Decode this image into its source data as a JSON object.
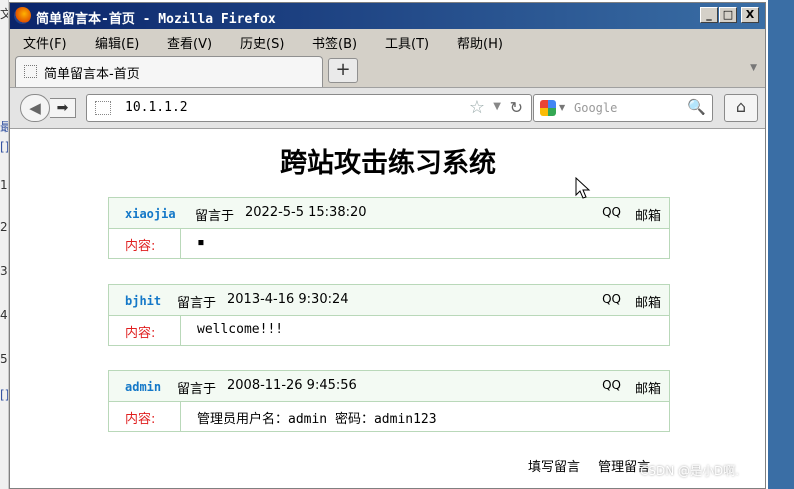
{
  "window": {
    "title": "简单留言本-首页 - Mozilla Firefox",
    "controls": {
      "minimize": "_",
      "maximize": "□",
      "close": "X"
    }
  },
  "menubar": [
    "文件(F)",
    "编辑(E)",
    "查看(V)",
    "历史(S)",
    "书签(B)",
    "工具(T)",
    "帮助(H)"
  ],
  "tabs": [
    {
      "label": "简单留言本-首页"
    }
  ],
  "newtab_label": "+",
  "navigation": {
    "url": "10.1.1.2",
    "search_placeholder": "Google"
  },
  "background_left_text": [
    "文",
    "最",
    "[]",
    "1",
    "2",
    "3",
    "4",
    "5",
    "[]"
  ],
  "page": {
    "title": "跨站攻击练习系统",
    "posted_prefix": "留言于",
    "qq_label": "QQ",
    "email_label": "邮箱",
    "content_label": "内容:",
    "messages": [
      {
        "author": "xiaojia",
        "datetime": "2022-5-5 15:38:20",
        "content": "▪"
      },
      {
        "author": "bjhit",
        "datetime": "2013-4-16 9:30:24",
        "content": "wellcome!!!"
      },
      {
        "author": "admin",
        "datetime": "2008-11-26 9:45:56",
        "content": "管理员用户名：admin 密码：admin123"
      }
    ],
    "footer_links": [
      "填写留言",
      "管理留言"
    ]
  },
  "watermark": "CSDN @是小D啊."
}
